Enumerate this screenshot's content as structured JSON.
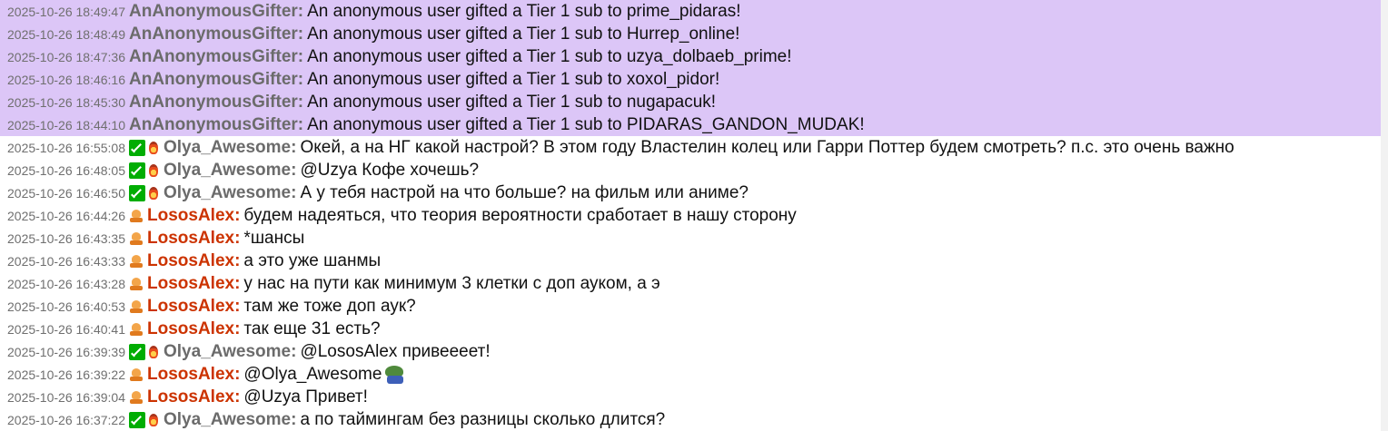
{
  "colors": {
    "gift_highlight": "#dcc6f7",
    "gifter_name": "#6b6b6b",
    "olya_name": "#6b6b6b",
    "losos_name": "#cc3300",
    "timestamp": "#6f6f6f",
    "text": "#111111"
  },
  "messages": [
    {
      "time": "2025-10-26 18:49:47",
      "user": "AnAnonymousGifter:",
      "text": "An anonymous user gifted a Tier 1 sub to prime_pidaras!",
      "highlight": true,
      "badges": [],
      "color": "#6b6b6b"
    },
    {
      "time": "2025-10-26 18:48:49",
      "user": "AnAnonymousGifter:",
      "text": "An anonymous user gifted a Tier 1 sub to Hurrep_online!",
      "highlight": true,
      "badges": [],
      "color": "#6b6b6b"
    },
    {
      "time": "2025-10-26 18:47:36",
      "user": "AnAnonymousGifter:",
      "text": "An anonymous user gifted a Tier 1 sub to uzya_dolbaeb_prime!",
      "highlight": true,
      "badges": [],
      "color": "#6b6b6b"
    },
    {
      "time": "2025-10-26 18:46:16",
      "user": "AnAnonymousGifter:",
      "text": "An anonymous user gifted a Tier 1 sub to xoxol_pidor!",
      "highlight": true,
      "badges": [],
      "color": "#6b6b6b"
    },
    {
      "time": "2025-10-26 18:45:30",
      "user": "AnAnonymousGifter:",
      "text": "An anonymous user gifted a Tier 1 sub to nugapacuk!",
      "highlight": true,
      "badges": [],
      "color": "#6b6b6b"
    },
    {
      "time": "2025-10-26 18:44:10",
      "user": "AnAnonymousGifter:",
      "text": "An anonymous user gifted a Tier 1 sub to PIDARAS_GANDON_MUDAK!",
      "highlight": true,
      "badges": [],
      "color": "#6b6b6b"
    },
    {
      "time": "2025-10-26 16:55:08",
      "user": "Olya_Awesome:",
      "text": "Окей, а на НГ какой настрой? В этом году Властелин колец или Гарри Поттер будем смотреть? п.с. это очень важно",
      "highlight": false,
      "badges": [
        "moderator-sword-icon",
        "subscriber-flame-icon"
      ],
      "color": "#6b6b6b"
    },
    {
      "time": "2025-10-26 16:48:05",
      "user": "Olya_Awesome:",
      "text": "@Uzya Кофе хочешь?",
      "highlight": false,
      "badges": [
        "moderator-sword-icon",
        "subscriber-flame-icon"
      ],
      "color": "#6b6b6b"
    },
    {
      "time": "2025-10-26 16:46:50",
      "user": "Olya_Awesome:",
      "text": "А у тебя настрой на что больше? на фильм или аниме?",
      "highlight": false,
      "badges": [
        "moderator-sword-icon",
        "subscriber-flame-icon"
      ],
      "color": "#6b6b6b"
    },
    {
      "time": "2025-10-26 16:44:26",
      "user": "LososAlex:",
      "text": "будем надеяться, что теория вероятности сработает в нашу сторону",
      "highlight": false,
      "badges": [
        "subscriber-hat-icon"
      ],
      "color": "#cc3300"
    },
    {
      "time": "2025-10-26 16:43:35",
      "user": "LososAlex:",
      "text": "*шансы",
      "highlight": false,
      "badges": [
        "subscriber-hat-icon"
      ],
      "color": "#cc3300"
    },
    {
      "time": "2025-10-26 16:43:33",
      "user": "LososAlex:",
      "text": "а это уже шанмы",
      "highlight": false,
      "badges": [
        "subscriber-hat-icon"
      ],
      "color": "#cc3300"
    },
    {
      "time": "2025-10-26 16:43:28",
      "user": "LososAlex:",
      "text": "у нас на пути как минимум 3 клетки с доп ауком, а э",
      "highlight": false,
      "badges": [
        "subscriber-hat-icon"
      ],
      "color": "#cc3300"
    },
    {
      "time": "2025-10-26 16:40:53",
      "user": "LososAlex:",
      "text": "там же тоже доп аук?",
      "highlight": false,
      "badges": [
        "subscriber-hat-icon"
      ],
      "color": "#cc3300"
    },
    {
      "time": "2025-10-26 16:40:41",
      "user": "LososAlex:",
      "text": "так еще 31 есть?",
      "highlight": false,
      "badges": [
        "subscriber-hat-icon"
      ],
      "color": "#cc3300"
    },
    {
      "time": "2025-10-26 16:39:39",
      "user": "Olya_Awesome:",
      "text": "@LososAlex привеееет!",
      "highlight": false,
      "badges": [
        "moderator-sword-icon",
        "subscriber-flame-icon"
      ],
      "color": "#6b6b6b"
    },
    {
      "time": "2025-10-26 16:39:22",
      "user": "LososAlex:",
      "text": "@Olya_Awesome",
      "highlight": false,
      "badges": [
        "subscriber-hat-icon"
      ],
      "color": "#cc3300",
      "emote": "pepe-emote-icon"
    },
    {
      "time": "2025-10-26 16:39:04",
      "user": "LososAlex:",
      "text": "@Uzya Привет!",
      "highlight": false,
      "badges": [
        "subscriber-hat-icon"
      ],
      "color": "#cc3300"
    },
    {
      "time": "2025-10-26 16:37:22",
      "user": "Olya_Awesome:",
      "text": "а по таймингам без разницы сколько длится?",
      "highlight": false,
      "badges": [
        "moderator-sword-icon",
        "subscriber-flame-icon"
      ],
      "color": "#6b6b6b"
    }
  ]
}
